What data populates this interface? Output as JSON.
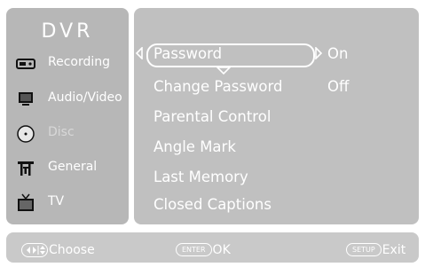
{
  "sidebar": {
    "title": "DVR",
    "items": [
      {
        "label": "Recording",
        "icon": "recording-icon"
      },
      {
        "label": "Audio/Video",
        "icon": "monitor-icon"
      },
      {
        "label": "Disc",
        "icon": "disc-icon",
        "state": "disabled"
      },
      {
        "label": "General",
        "icon": "general-settings-icon"
      },
      {
        "label": "TV",
        "icon": "tv-icon"
      }
    ]
  },
  "menu": {
    "items": [
      {
        "label": "Password",
        "value": "On"
      },
      {
        "label": "Change Password",
        "value": "Off"
      },
      {
        "label": "Parental Control"
      },
      {
        "label": "Angle Mark"
      },
      {
        "label": "Last Memory"
      },
      {
        "label": "Closed Captions"
      }
    ],
    "selected_index": 0
  },
  "footer": {
    "choose_label": "Choose",
    "enter_key": "ENTER",
    "ok_label": "OK",
    "setup_key": "SETUP",
    "exit_label": "Exit"
  },
  "colors": {
    "sidebar_bg": "#b7b7b7",
    "main_bg": "#c0c0c0",
    "footer_bg": "#c9c9c9",
    "text": "#ffffff"
  }
}
